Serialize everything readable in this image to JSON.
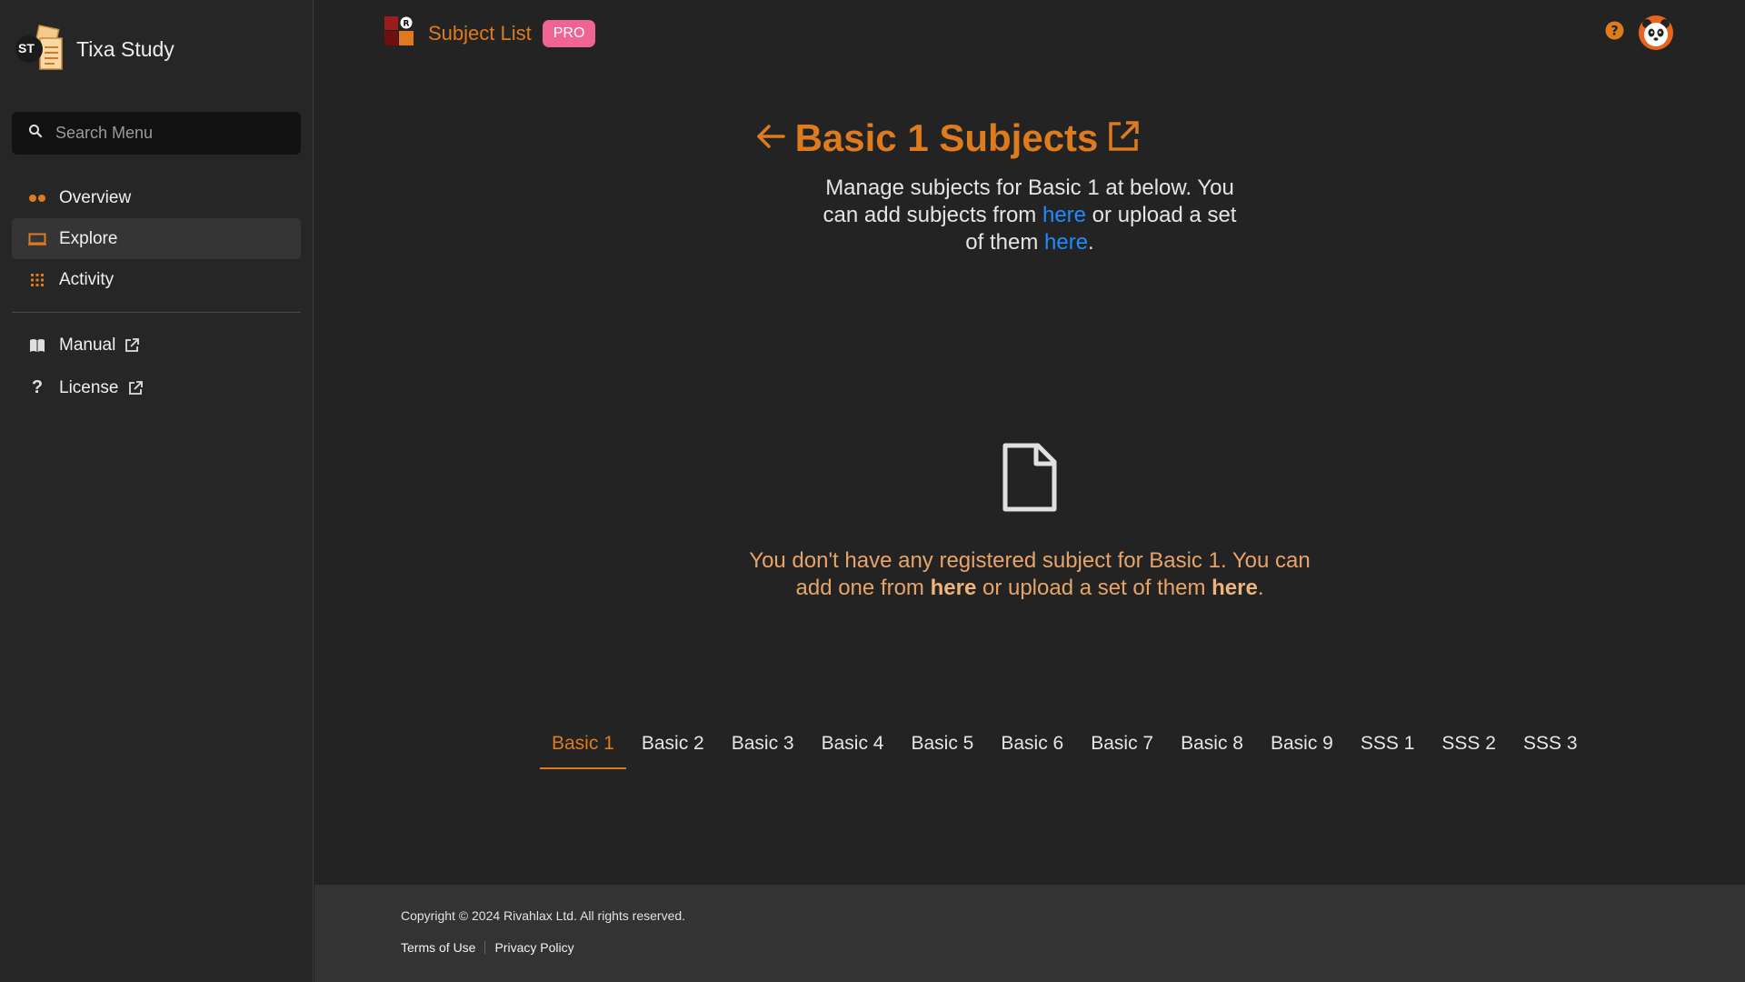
{
  "sidebar": {
    "brand": {
      "logo_text": "ST",
      "name": "Tixa Study"
    },
    "search": {
      "placeholder": "Search Menu"
    },
    "items": [
      {
        "label": "Overview",
        "icon": "dots-icon"
      },
      {
        "label": "Explore",
        "icon": "monitor-icon",
        "active": true
      },
      {
        "label": "Activity",
        "icon": "grid-icon"
      }
    ],
    "links": [
      {
        "label": "Manual",
        "icon": "book-icon"
      },
      {
        "label": "License",
        "icon": "question-icon"
      }
    ]
  },
  "header": {
    "title": "Subject List",
    "badge": "PRO"
  },
  "main": {
    "heading": "Basic 1 Subjects",
    "desc": {
      "part1": "Manage subjects for Basic 1 at below. You can add subjects from ",
      "link1": "here",
      "part2": " or upload a set of them ",
      "link2": "here",
      "part3": "."
    },
    "empty": {
      "part1": "You don't have any registered subject for Basic 1. You can add one from ",
      "link1": "here",
      "part2": " or upload a set of them ",
      "link2": "here",
      "part3": "."
    },
    "tabs": [
      "Basic 1",
      "Basic 2",
      "Basic 3",
      "Basic 4",
      "Basic 5",
      "Basic 6",
      "Basic 7",
      "Basic 8",
      "Basic 9",
      "SSS 1",
      "SSS 2",
      "SSS 3"
    ]
  },
  "footer": {
    "copyright": "Copyright © 2024 Rivahlax Ltd. All rights reserved.",
    "terms": "Terms of Use",
    "privacy": "Privacy Policy"
  },
  "colors": {
    "accent": "#dd7b1e",
    "badge": "#f06493",
    "link": "#1e8bff",
    "background": "#232323",
    "sidebar": "#262626",
    "footer": "#333333"
  }
}
